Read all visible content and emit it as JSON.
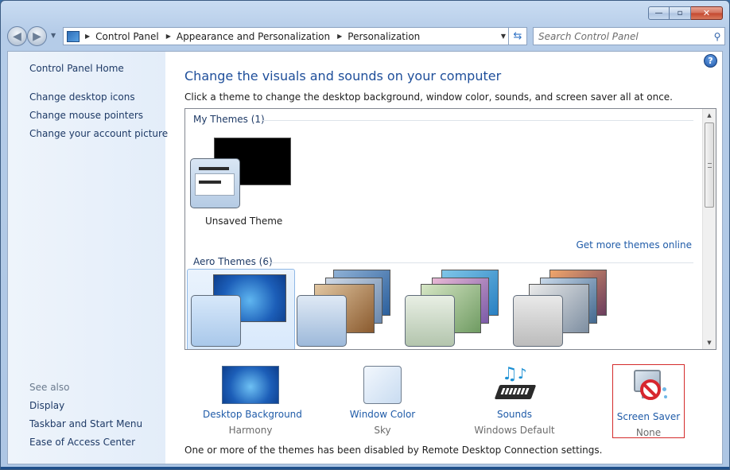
{
  "window": {
    "minimize_glyph": "—",
    "maximize_glyph": "▫",
    "close_glyph": "✕"
  },
  "nav": {
    "back_glyph": "◀",
    "forward_glyph": "▶",
    "breadcrumb": [
      "Control Panel",
      "Appearance and Personalization",
      "Personalization"
    ],
    "search_placeholder": "Search Control Panel"
  },
  "sidebar": {
    "home": "Control Panel Home",
    "tasks": [
      "Change desktop icons",
      "Change mouse pointers",
      "Change your account picture"
    ],
    "see_also_label": "See also",
    "see_also": [
      "Display",
      "Taskbar and Start Menu",
      "Ease of Access Center"
    ]
  },
  "main": {
    "title": "Change the visuals and sounds on your computer",
    "description": "Click a theme to change the desktop background, window color, sounds, and screen saver all at once.",
    "my_themes_label": "My Themes (1)",
    "unsaved_theme": "Unsaved Theme",
    "get_more_link": "Get more themes online",
    "aero_themes_label": "Aero Themes (6)",
    "footer_note": "One or more of the themes has been disabled by Remote Desktop Connection settings."
  },
  "tiles": [
    {
      "name": "Desktop Background",
      "value": "Harmony"
    },
    {
      "name": "Window Color",
      "value": "Sky"
    },
    {
      "name": "Sounds",
      "value": "Windows Default"
    },
    {
      "name": "Screen Saver",
      "value": "None"
    }
  ],
  "colors": {
    "link": "#1f5ba8",
    "title": "#1e4e9a",
    "highlight_border": "#d42b2b"
  }
}
